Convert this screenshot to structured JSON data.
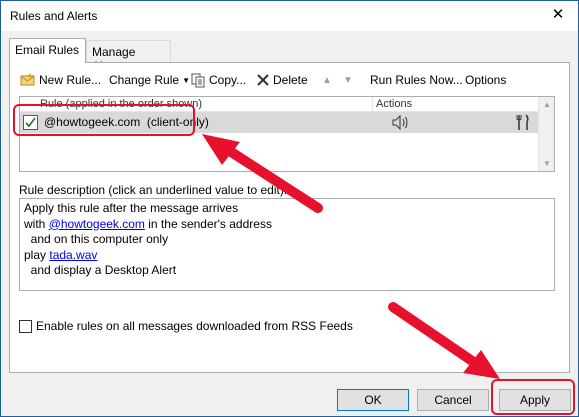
{
  "window": {
    "title": "Rules and Alerts"
  },
  "tabs": [
    {
      "label": "Email Rules",
      "active": true
    },
    {
      "label": "Manage Alerts",
      "active": false
    }
  ],
  "toolbar": {
    "new_rule": "New Rule...",
    "change_rule": "Change Rule",
    "copy": "Copy...",
    "delete": "Delete",
    "run_rules_now": "Run Rules Now...",
    "options": "Options"
  },
  "rules_list": {
    "header_rule": "Rule (applied in the order shown)",
    "header_actions": "Actions",
    "rows": [
      {
        "name": "@howtogeek.com  (client-only)",
        "enabled": true
      }
    ]
  },
  "description": {
    "label": "Rule description (click an underlined value to edit):",
    "lines": {
      "l1": "Apply this rule after the message arrives",
      "l2_pre": "with ",
      "l2_link": "@howtogeek.com",
      "l2_post": " in the sender's address",
      "l3": "  and on this computer only",
      "l4_pre": "play ",
      "l4_link": "tada.wav",
      "l5": "  and display a Desktop Alert"
    }
  },
  "rss": {
    "label": "Enable rules on all messages downloaded from RSS Feeds",
    "checked": false
  },
  "buttons": {
    "ok": "OK",
    "cancel": "Cancel",
    "apply": "Apply"
  },
  "colors": {
    "annotation": "#e8112d",
    "accent": "#0078d7",
    "selected_row": "#d9d9d9"
  }
}
